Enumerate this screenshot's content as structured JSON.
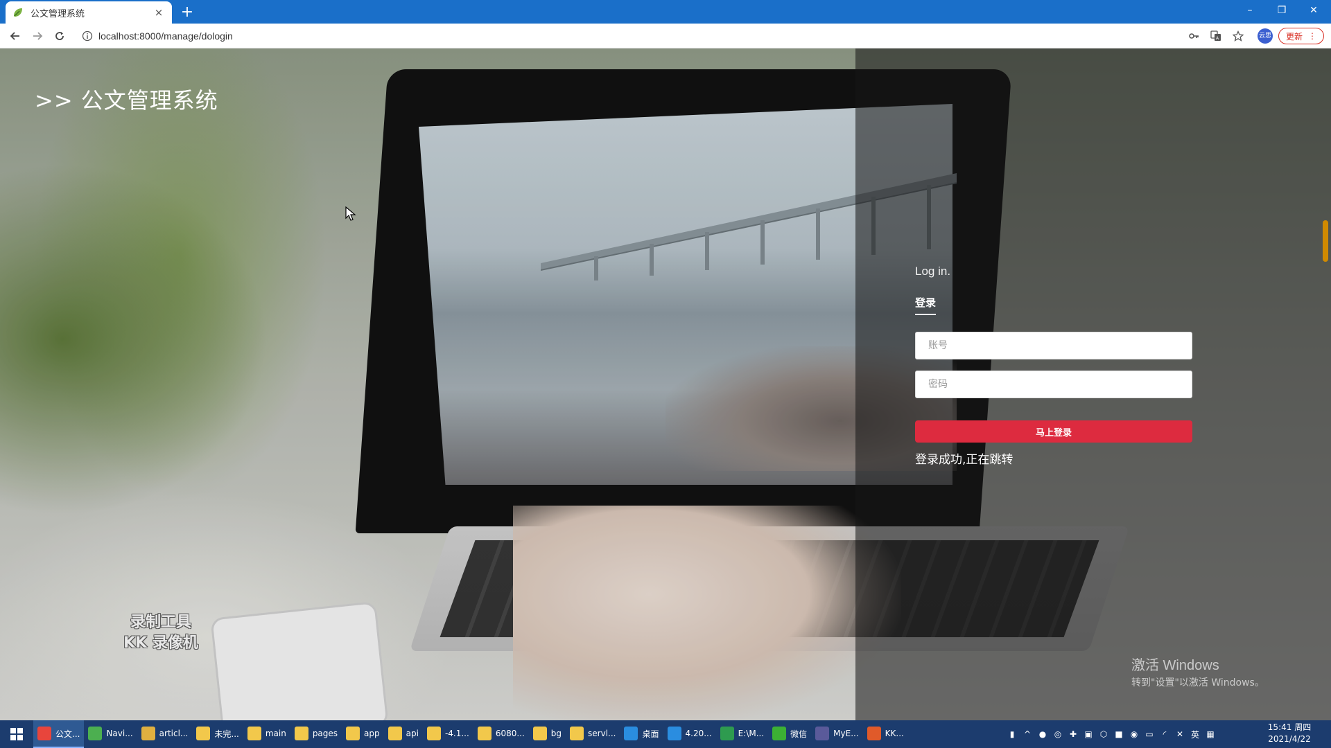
{
  "browser": {
    "tab_title": "公文管理系统",
    "tab_close": "×",
    "new_tab": "+",
    "url": "localhost:8000/manage/dologin",
    "avatar_label": "云思",
    "update_label": "更新",
    "window_min": "–",
    "window_restore": "❐",
    "window_close": "✕",
    "icons": [
      "back-icon",
      "forward-icon",
      "reload-icon",
      "info-icon",
      "key-icon",
      "translate-icon",
      "star-icon",
      "menu-dots-icon"
    ]
  },
  "page": {
    "site_title": ">> 公文管理系统",
    "watermark_line1": "录制工具",
    "watermark_line2": "KK 录像机",
    "login": {
      "heading": "Log in.",
      "tab_label": "登录",
      "username_placeholder": "账号",
      "password_placeholder": "密码",
      "submit_label": "马上登录",
      "status_text": "登录成功,正在跳转"
    },
    "activation": {
      "line1": "激活 Windows",
      "line2": "转到\"设置\"以激活 Windows。"
    },
    "colors": {
      "accent": "#dd2b3f",
      "browser_bar": "#1a6fc9",
      "taskbar": "#1c3c6e"
    }
  },
  "taskbar": {
    "items": [
      {
        "label": "公文...",
        "icon": "chrome-icon",
        "color": "#e8453c",
        "active": true
      },
      {
        "label": "Navi...",
        "icon": "leaf-icon",
        "color": "#4caf50",
        "active": false
      },
      {
        "label": "articl...",
        "icon": "folder-icon",
        "color": "#e0b040",
        "active": false
      },
      {
        "label": "未完...",
        "icon": "folder-icon",
        "color": "#f2c84b",
        "active": false
      },
      {
        "label": "main",
        "icon": "folder-icon",
        "color": "#f2c84b",
        "active": false
      },
      {
        "label": "pages",
        "icon": "folder-icon",
        "color": "#f2c84b",
        "active": false
      },
      {
        "label": "app",
        "icon": "folder-icon",
        "color": "#f2c84b",
        "active": false
      },
      {
        "label": "api",
        "icon": "folder-icon",
        "color": "#f2c84b",
        "active": false
      },
      {
        "label": "-4.1...",
        "icon": "folder-icon",
        "color": "#f2c84b",
        "active": false
      },
      {
        "label": "6080...",
        "icon": "folder-icon",
        "color": "#f2c84b",
        "active": false
      },
      {
        "label": "bg",
        "icon": "folder-icon",
        "color": "#f2c84b",
        "active": false
      },
      {
        "label": "servl...",
        "icon": "folder-icon",
        "color": "#f2c84b",
        "active": false
      },
      {
        "label": "桌面",
        "icon": "desktop-icon",
        "color": "#2a8de0",
        "active": false
      },
      {
        "label": "4.20...",
        "icon": "vscode-icon",
        "color": "#2a8de0",
        "active": false
      },
      {
        "label": "E:\\M...",
        "icon": "excel-icon",
        "color": "#2e9b4f",
        "active": false
      },
      {
        "label": "微信",
        "icon": "wechat-icon",
        "color": "#3cb034",
        "active": false
      },
      {
        "label": "MyE...",
        "icon": "eclipse-icon",
        "color": "#5a5a9a",
        "active": false
      },
      {
        "label": "KK...",
        "icon": "record-icon",
        "color": "#e05a2a",
        "active": false
      }
    ],
    "tray": {
      "ime": "英",
      "time": "15:41 周四",
      "date": "2021/4/22"
    }
  }
}
